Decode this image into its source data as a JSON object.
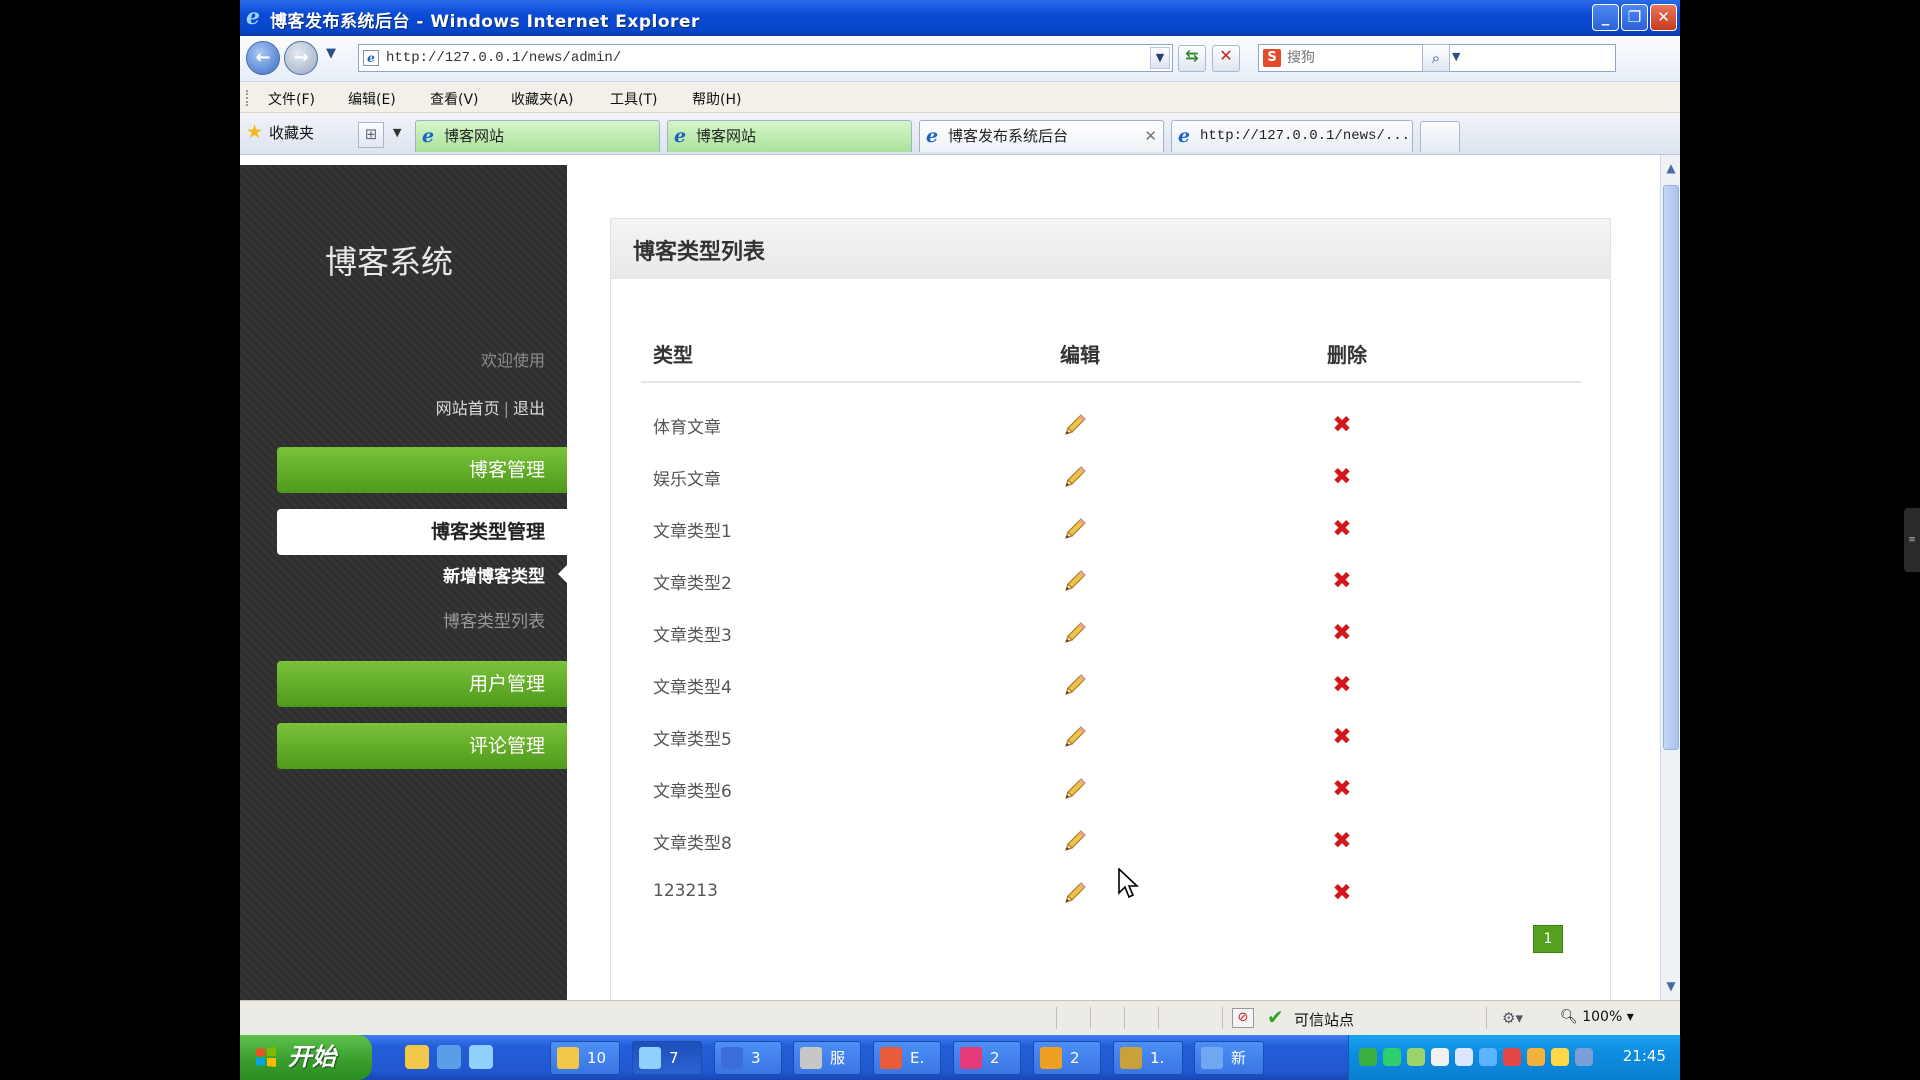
{
  "window": {
    "title": "博客发布系统后台 - Windows Internet Explorer",
    "controls": {
      "minimize": "_",
      "restore": "❐",
      "close": "✕"
    }
  },
  "address_bar": {
    "url": "http://127.0.0.1/news/admin/",
    "search_placeholder": "搜狗",
    "search_engine_logo": "S"
  },
  "menu": [
    "文件(F)",
    "编辑(E)",
    "查看(V)",
    "收藏夹(A)",
    "工具(T)",
    "帮助(H)"
  ],
  "favorites_label": "收藏夹",
  "tabs": [
    {
      "label": "博客网站",
      "active": false
    },
    {
      "label": "博客网站",
      "active": false
    },
    {
      "label": "博客发布系统后台",
      "active": true
    },
    {
      "label": "http://127.0.0.1/news/...",
      "active": false
    }
  ],
  "sidebar": {
    "title": "博客系统",
    "welcome": "欢迎使用",
    "link_home": "网站首页",
    "link_sep": "|",
    "link_logout": "退出",
    "menu_blog": "博客管理",
    "menu_blog_type": "博客类型管理",
    "sub_add_type": "新增博客类型",
    "sub_type_list": "博客类型列表",
    "menu_user": "用户管理",
    "menu_comment": "评论管理"
  },
  "panel": {
    "title": "博客类型列表",
    "columns": {
      "type": "类型",
      "edit": "编辑",
      "delete": "删除"
    },
    "rows": [
      {
        "type": "体育文章"
      },
      {
        "type": "娱乐文章"
      },
      {
        "type": "文章类型1"
      },
      {
        "type": "文章类型2"
      },
      {
        "type": "文章类型3"
      },
      {
        "type": "文章类型4"
      },
      {
        "type": "文章类型5"
      },
      {
        "type": "文章类型6"
      },
      {
        "type": "文章类型8"
      },
      {
        "type": "123213"
      }
    ],
    "pager_current": "1",
    "icons": {
      "edit": "pencil-icon",
      "delete": "red-x-icon"
    }
  },
  "status_bar": {
    "zone": "可信站点",
    "zoom": "100%"
  },
  "taskbar": {
    "start_label": "开始",
    "buttons": [
      {
        "label": "10",
        "icon": "folder-icon"
      },
      {
        "label": "7",
        "icon": "ie-icon"
      },
      {
        "label": "3",
        "icon": "word-icon"
      },
      {
        "label": "服",
        "icon": "gear-icon"
      },
      {
        "label": "E.",
        "icon": "app-icon"
      },
      {
        "label": "2",
        "icon": "app-icon"
      },
      {
        "label": "2",
        "icon": "qq-icon"
      },
      {
        "label": "1.",
        "icon": "fw-icon"
      },
      {
        "label": "新",
        "icon": "doc-icon"
      }
    ],
    "clock": "21:45"
  },
  "colors": {
    "sidebar_bg": "#333333",
    "menu_green": "#5aa622",
    "delete_red": "#d4161b",
    "pager_green": "#55a01f",
    "titlebar_blue": "#0a4ad6"
  }
}
